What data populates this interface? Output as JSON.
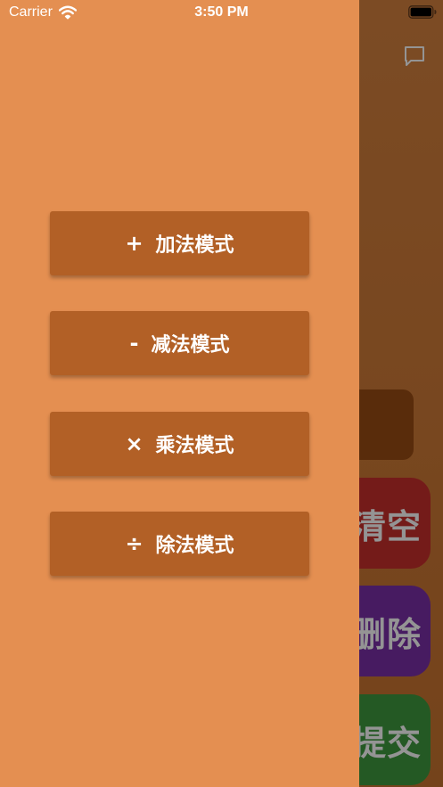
{
  "status_bar": {
    "carrier": "Carrier",
    "time": "3:50 PM"
  },
  "background_app": {
    "icons": {
      "chat": "chat-bubble-icon"
    },
    "buttons": {
      "clear": "清空",
      "delete": "删除",
      "submit": "提交"
    },
    "colors": {
      "clear": "#c9302c",
      "delete": "#7b2fa8",
      "submit": "#3e9a3e"
    }
  },
  "drawer": {
    "modes": [
      {
        "symbol": "+",
        "label": "加法模式"
      },
      {
        "symbol": "-",
        "label": "减法模式"
      },
      {
        "symbol": "×",
        "label": "乘法模式"
      },
      {
        "symbol": "÷",
        "label": "除法模式"
      }
    ],
    "colors": {
      "background": "#e48f51",
      "button": "#b26026"
    }
  }
}
